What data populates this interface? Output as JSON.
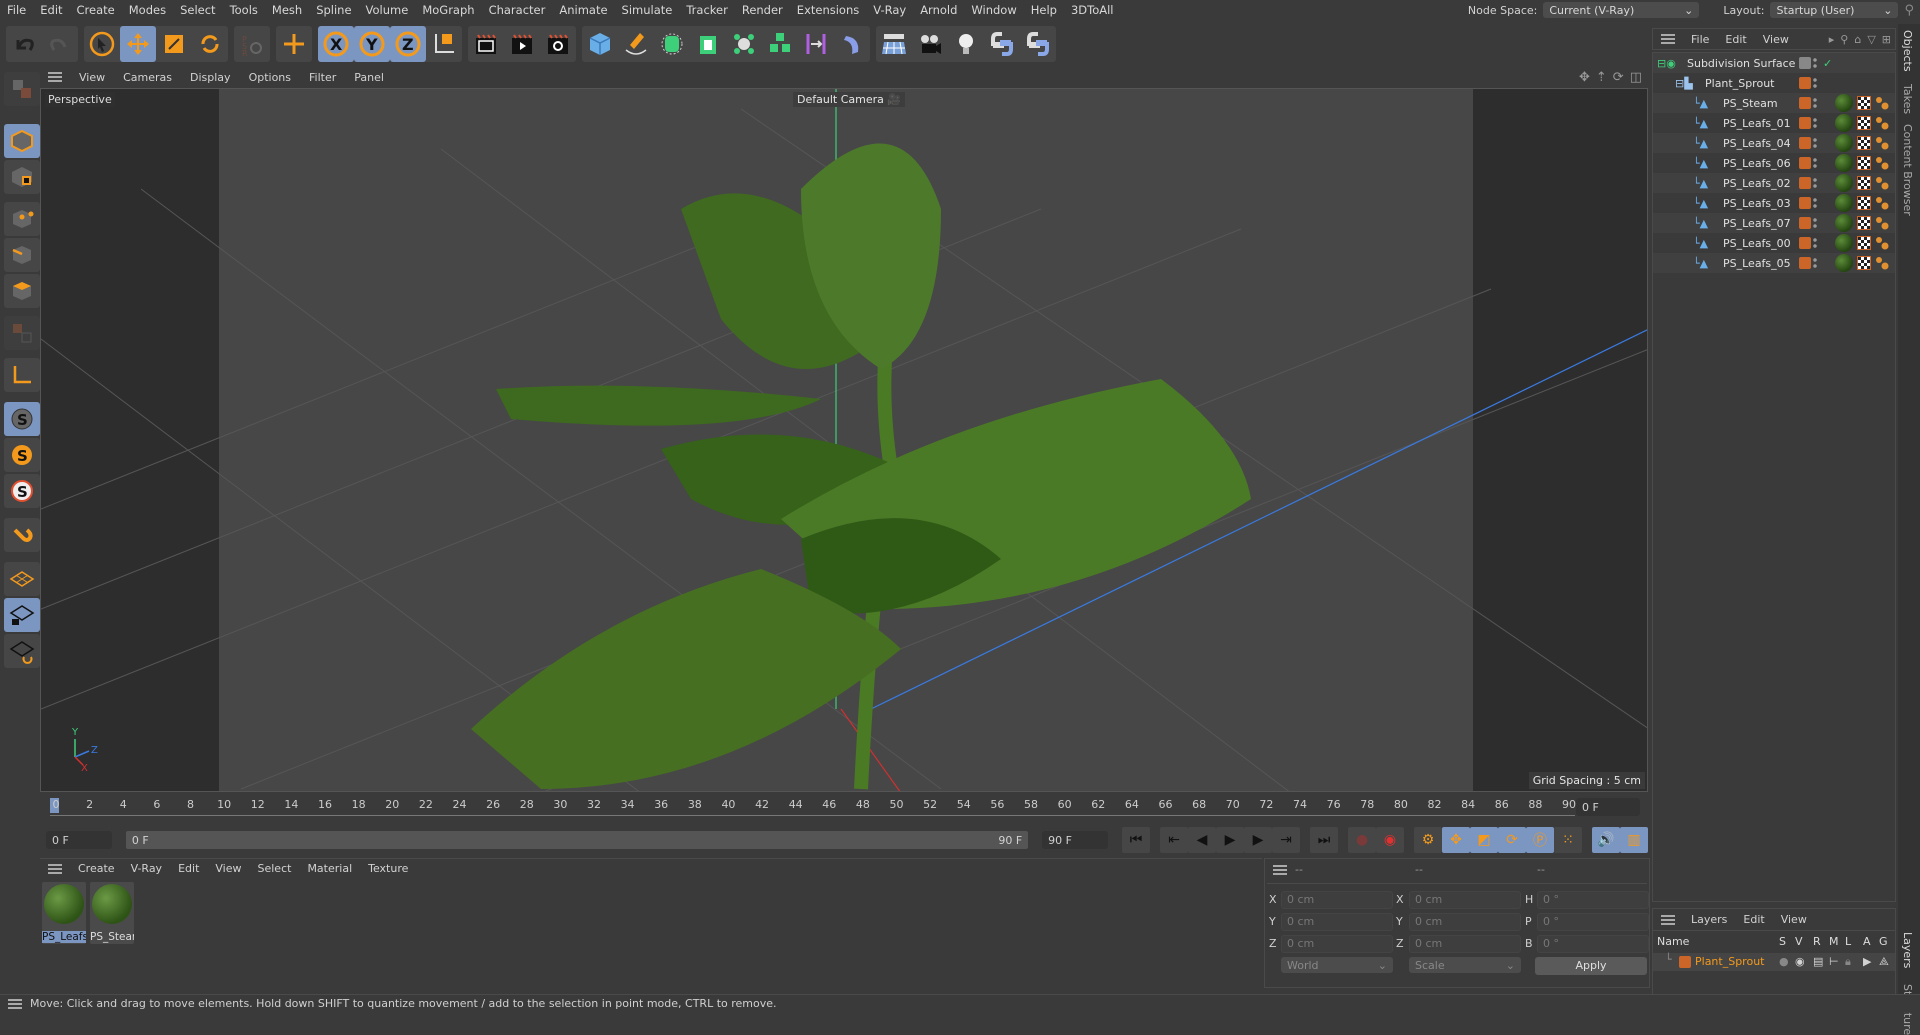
{
  "menubar": {
    "items": [
      "File",
      "Edit",
      "Create",
      "Modes",
      "Select",
      "Tools",
      "Mesh",
      "Spline",
      "Volume",
      "MoGraph",
      "Character",
      "Animate",
      "Simulate",
      "Tracker",
      "Render",
      "Extensions",
      "V-Ray",
      "Arnold",
      "Window",
      "Help",
      "3DToAll"
    ],
    "node_space_label": "Node Space:",
    "node_space_value": "Current (V-Ray)",
    "layout_label": "Layout:",
    "layout_value": "Startup (User)"
  },
  "toolbar": {
    "icons": [
      "undo-icon",
      "redo-icon",
      "select-icon",
      "move-icon",
      "scale-icon",
      "rotate-icon",
      "psr-icon",
      "add-axis-icon",
      "x-axis-lock-icon",
      "y-axis-lock-icon",
      "z-axis-lock-icon",
      "coordinate-system-icon",
      "render-region-icon",
      "render-view-icon",
      "render-settings-icon",
      "cube-icon",
      "pen-icon",
      "subdivision-icon",
      "extrude-icon",
      "cloner-icon",
      "mograph-icon",
      "symmetry-icon",
      "deformer-icon",
      "floor-icon",
      "camera-icon",
      "light-icon",
      "python-icon",
      "python-icon-2"
    ]
  },
  "viewport": {
    "menu": [
      "View",
      "Cameras",
      "Display",
      "Options",
      "Filter",
      "Panel"
    ],
    "view_name": "Perspective",
    "camera_name": "Default Camera",
    "grid_spacing": "Grid Spacing : 5 cm",
    "axis_labels": {
      "x": "X",
      "y": "Y",
      "z": "Z"
    }
  },
  "timeline": {
    "ticks": [
      "0",
      "2",
      "4",
      "6",
      "8",
      "10",
      "12",
      "14",
      "16",
      "18",
      "20",
      "22",
      "24",
      "26",
      "28",
      "30",
      "32",
      "34",
      "36",
      "38",
      "40",
      "42",
      "44",
      "46",
      "48",
      "50",
      "52",
      "54",
      "56",
      "58",
      "60",
      "62",
      "64",
      "66",
      "68",
      "70",
      "72",
      "74",
      "76",
      "78",
      "80",
      "82",
      "84",
      "86",
      "88",
      "90"
    ],
    "current_frame": "0 F",
    "start_frame": "0 F",
    "range_start": "0 F",
    "range_end": "90 F",
    "end_frame": "90 F"
  },
  "materials": {
    "menu": [
      "Create",
      "V-Ray",
      "Edit",
      "View",
      "Select",
      "Material",
      "Texture"
    ],
    "items": [
      {
        "name": "PS_Leafs",
        "selected": true
      },
      {
        "name": "PS_Stear",
        "selected": false
      }
    ]
  },
  "coordinates": {
    "headers": [
      "--",
      "--",
      "--"
    ],
    "rows": [
      {
        "l1": "X",
        "v1": "0 cm",
        "l2": "X",
        "v2": "0 cm",
        "l3": "H",
        "v3": "0 °"
      },
      {
        "l1": "Y",
        "v1": "0 cm",
        "l2": "Y",
        "v2": "0 cm",
        "l3": "P",
        "v3": "0 °"
      },
      {
        "l1": "Z",
        "v1": "0 cm",
        "l2": "Z",
        "v2": "0 cm",
        "l3": "B",
        "v3": "0 °"
      }
    ],
    "space": "World",
    "mode": "Scale",
    "apply_label": "Apply"
  },
  "objects": {
    "menu": [
      "File",
      "Edit",
      "View"
    ],
    "tree": [
      {
        "name": "Subdivision Surface",
        "depth": 0,
        "type": "subdivision"
      },
      {
        "name": "Plant_Sprout",
        "depth": 1,
        "type": "null"
      },
      {
        "name": "PS_Steam",
        "depth": 2,
        "type": "polygon"
      },
      {
        "name": "PS_Leafs_01",
        "depth": 2,
        "type": "polygon"
      },
      {
        "name": "PS_Leafs_04",
        "depth": 2,
        "type": "polygon"
      },
      {
        "name": "PS_Leafs_06",
        "depth": 2,
        "type": "polygon"
      },
      {
        "name": "PS_Leafs_02",
        "depth": 2,
        "type": "polygon"
      },
      {
        "name": "PS_Leafs_03",
        "depth": 2,
        "type": "polygon"
      },
      {
        "name": "PS_Leafs_07",
        "depth": 2,
        "type": "polygon"
      },
      {
        "name": "PS_Leafs_00",
        "depth": 2,
        "type": "polygon"
      },
      {
        "name": "PS_Leafs_05",
        "depth": 2,
        "type": "polygon"
      }
    ],
    "layer_color": "#cc6628"
  },
  "side_tabs": [
    "Objects",
    "Takes",
    "Content Browser",
    "Layers",
    "Structure"
  ],
  "layers": {
    "menu": [
      "Layers",
      "Edit",
      "View"
    ],
    "columns": [
      "Name",
      "S",
      "V",
      "R",
      "M",
      "L",
      "A",
      "G"
    ],
    "rows": [
      {
        "name": "Plant_Sprout",
        "color": "#cc6628"
      }
    ]
  },
  "status": {
    "text": "Move: Click and drag to move elements. Hold down SHIFT to quantize movement / add to the selection in point mode, CTRL to remove."
  },
  "colors": {
    "accent": "#7c96c2",
    "orange": "#f39a1d",
    "layer": "#cc6628"
  }
}
